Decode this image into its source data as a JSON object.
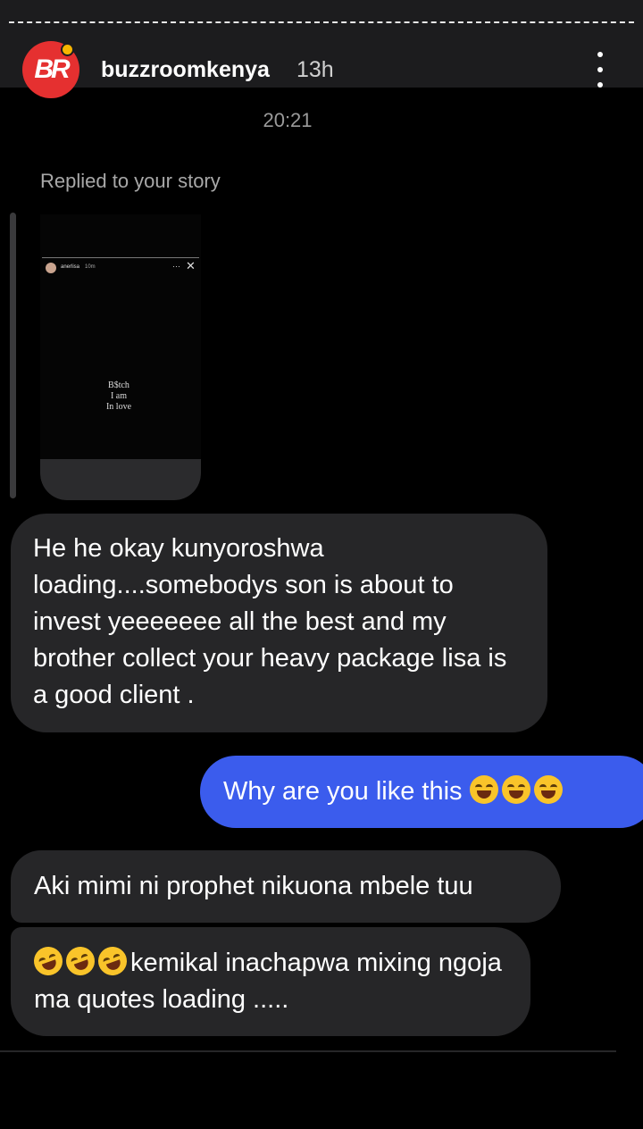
{
  "header": {
    "avatar_text": "BR",
    "username": "buzzroomkenya",
    "age": "13h"
  },
  "thread": {
    "timestamp": "20:21",
    "replied_label": "Replied to your story",
    "story_preview": {
      "username": "anerlisa",
      "time": "10m",
      "text_line1": "B$tch",
      "text_line2": "I am",
      "text_line3": "In love"
    }
  },
  "messages": [
    {
      "sender": "them",
      "text": "He he okay kunyoroshwa loading....somebodys son is about to invest yeeeeeee all the best and my brother collect your heavy package lisa is a good client ."
    },
    {
      "sender": "me",
      "text": "Why are you like this",
      "emoji": "face-with-tears-of-joy x3"
    },
    {
      "sender": "them",
      "text": "Aki mimi ni prophet nikuona mbele tuu"
    },
    {
      "sender": "them",
      "emoji": "rolling-on-the-floor-laughing x3",
      "text": "kemikal inachapwa mixing ngoja ma quotes loading ....."
    }
  ],
  "colors": {
    "incoming_bubble": "#262628",
    "outgoing_bubble": "#3b5ced",
    "header_bg": "#1c1c1e",
    "avatar": "#e53030"
  }
}
